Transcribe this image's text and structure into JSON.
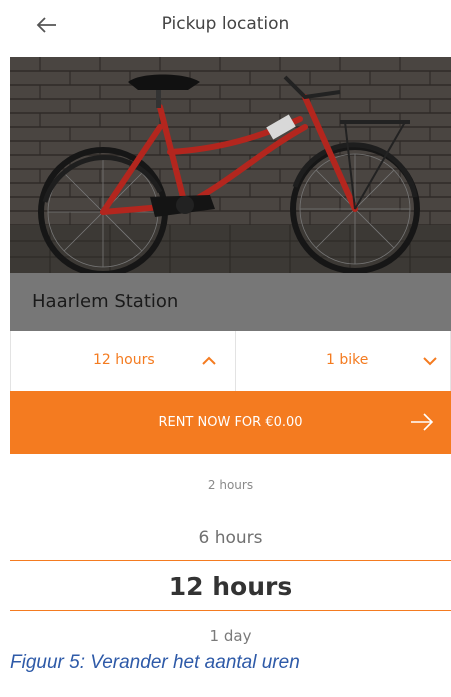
{
  "header": {
    "title": "Pickup location",
    "back_icon": "arrow-left-icon"
  },
  "hero": {
    "image_subject": "red bicycle against brick wall",
    "location_name": "Haarlem Station"
  },
  "selectors": {
    "duration": {
      "value": "12 hours",
      "icon": "chevron-up-icon"
    },
    "bikes": {
      "value": "1 bike",
      "icon": "chevron-down-icon"
    }
  },
  "rent_button": {
    "label": "RENT NOW FOR €0.00",
    "icon": "arrow-right-icon"
  },
  "picker": {
    "options": [
      "2 hours",
      "6 hours",
      "12 hours",
      "1 day"
    ],
    "selected": "12 hours"
  },
  "caption": "Figuur 5: Verander het aantal uren",
  "colors": {
    "accent": "#f47b20",
    "caption": "#2e5aa8"
  }
}
